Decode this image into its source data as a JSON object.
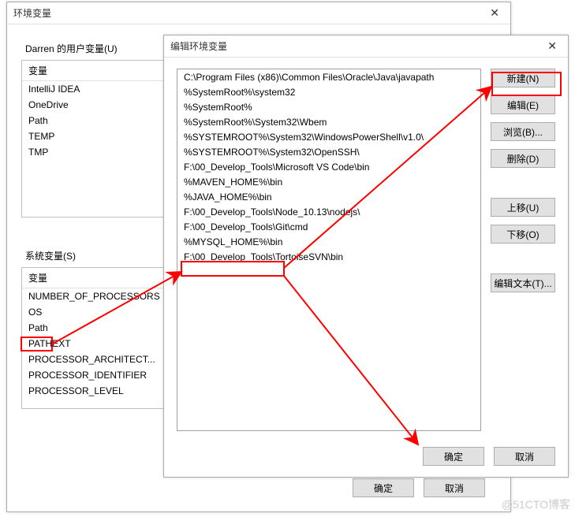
{
  "bg_dialog": {
    "title": "环境变量",
    "user_vars_label": "Darren 的用户变量(U)",
    "user_vars_header": "变量",
    "user_vars": [
      "IntelliJ IDEA",
      "OneDrive",
      "Path",
      "TEMP",
      "TMP"
    ],
    "sys_vars_label": "系统变量(S)",
    "sys_vars_header": "变量",
    "sys_vars": [
      "NUMBER_OF_PROCESSORS",
      "OS",
      "Path",
      "PATHEXT",
      "PROCESSOR_ARCHITECT...",
      "PROCESSOR_IDENTIFIER",
      "PROCESSOR_LEVEL"
    ],
    "ok": "确定",
    "cancel": "取消"
  },
  "fg_dialog": {
    "title": "编辑环境变量",
    "paths": [
      "C:\\Program Files (x86)\\Common Files\\Oracle\\Java\\javapath",
      "%SystemRoot%\\system32",
      "%SystemRoot%",
      "%SystemRoot%\\System32\\Wbem",
      "%SYSTEMROOT%\\System32\\WindowsPowerShell\\v1.0\\",
      "%SYSTEMROOT%\\System32\\OpenSSH\\",
      "F:\\00_Develop_Tools\\Microsoft VS Code\\bin",
      "%MAVEN_HOME%\\bin",
      "%JAVA_HOME%\\bin",
      "F:\\00_Develop_Tools\\Node_10.13\\nodejs\\",
      "F:\\00_Develop_Tools\\Git\\cmd",
      "%MYSQL_HOME%\\bin",
      "F:\\00_Develop_Tools\\TortoiseSVN\\bin"
    ],
    "btn_new": "新建(N)",
    "btn_edit": "编辑(E)",
    "btn_browse": "浏览(B)...",
    "btn_delete": "删除(D)",
    "btn_up": "上移(U)",
    "btn_down": "下移(O)",
    "btn_edit_text": "编辑文本(T)...",
    "ok": "确定",
    "cancel": "取消"
  },
  "watermark": "@51CTO博客"
}
